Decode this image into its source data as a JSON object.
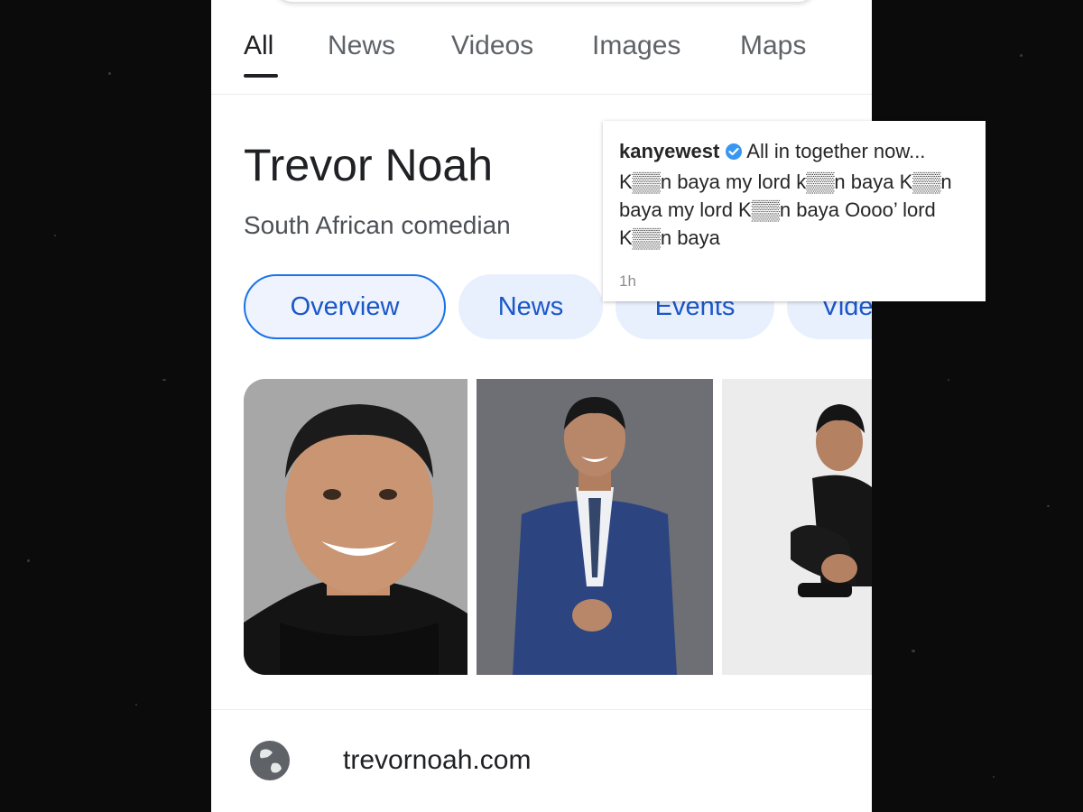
{
  "tabs": [
    {
      "label": "All",
      "active": true
    },
    {
      "label": "News"
    },
    {
      "label": "Videos"
    },
    {
      "label": "Images"
    },
    {
      "label": "Maps"
    }
  ],
  "entity": {
    "title": "Trevor Noah",
    "subtitle": "South African comedian"
  },
  "chips": [
    {
      "label": "Overview",
      "selected": true
    },
    {
      "label": "News"
    },
    {
      "label": "Events"
    },
    {
      "label": "Vide"
    }
  ],
  "website": {
    "icon": "globe-icon",
    "label": "trevornoah.com"
  },
  "instagram_post": {
    "username": "kanyewest",
    "verified_icon": "verified-badge-icon",
    "caption": "All in together now... K▒▒n baya my lord k▒▒n baya K▒▒n baya my lord K▒▒n baya Oooo’ lord K▒▒n baya",
    "timestamp": "1h"
  },
  "colors": {
    "accent": "#1a73e8",
    "chip_bg": "#e8effd",
    "verified": "#3897f0",
    "background": "#0b0b0b"
  }
}
